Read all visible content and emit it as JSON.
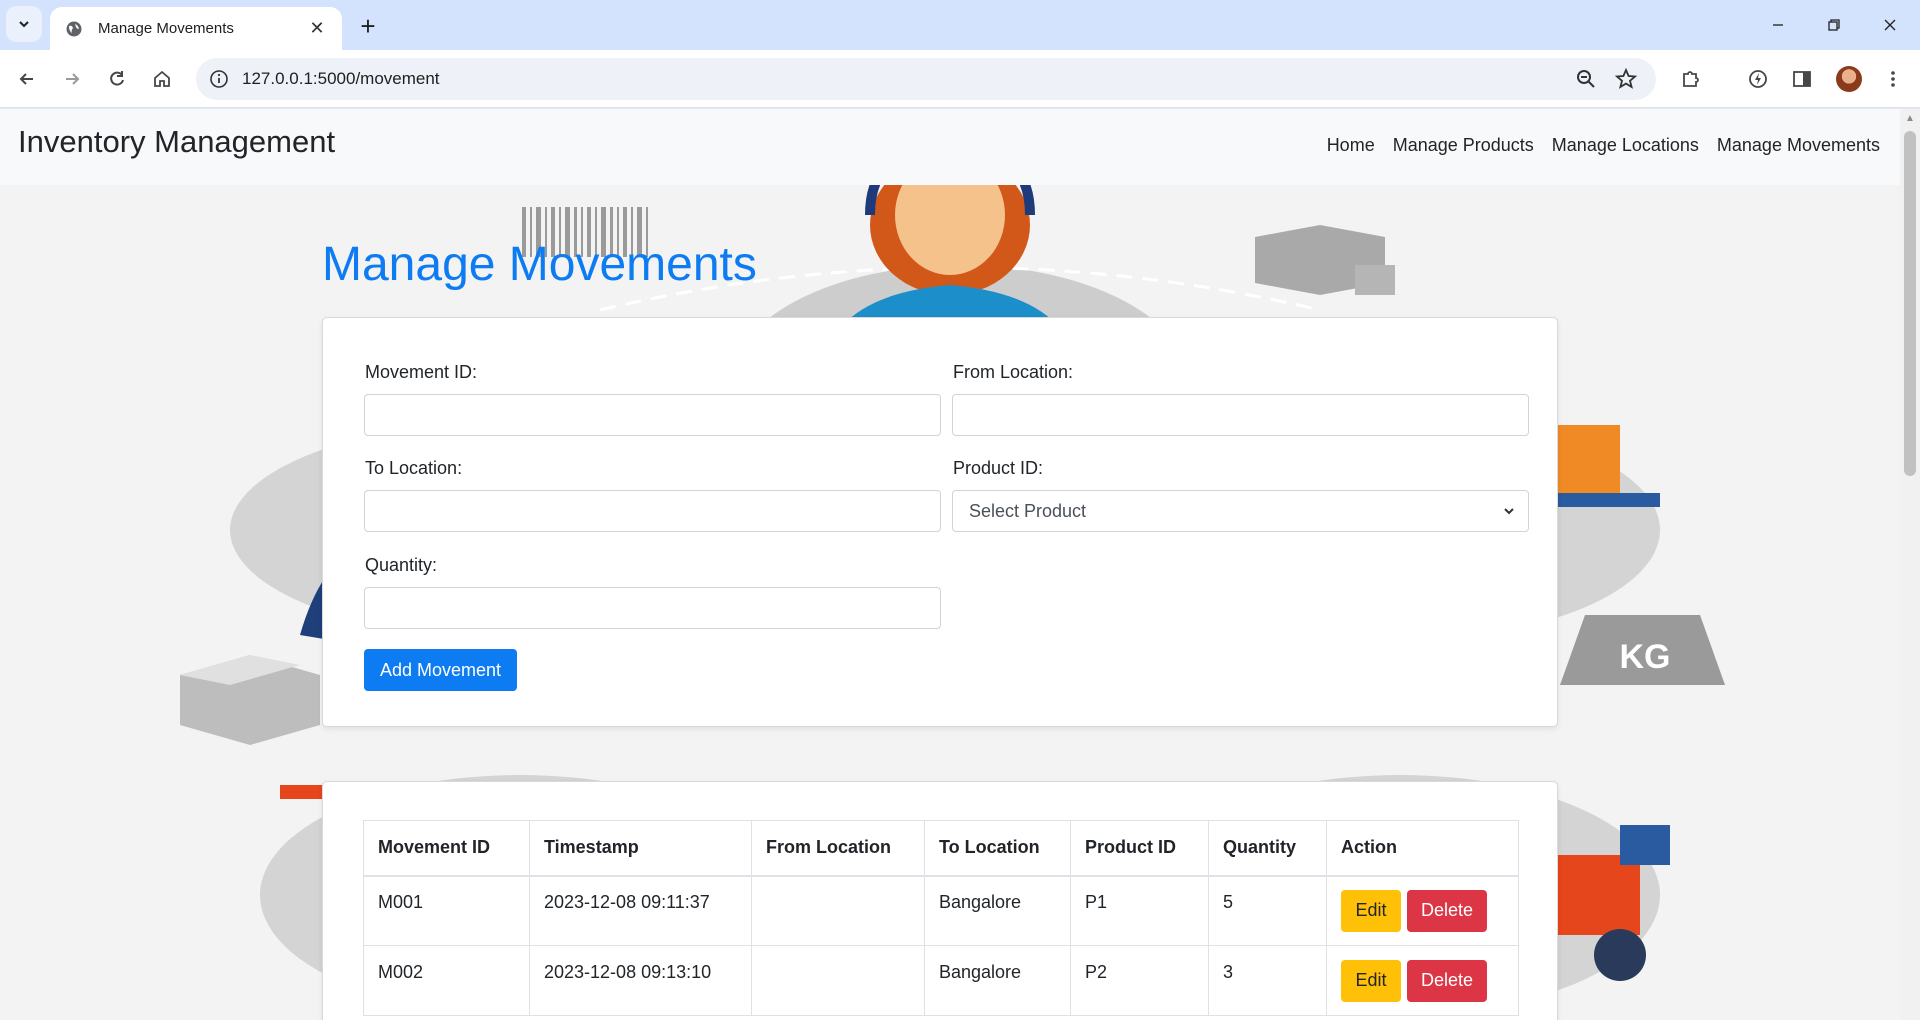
{
  "browser": {
    "tab_title": "Manage Movements",
    "url": "127.0.0.1:5000/movement"
  },
  "navbar": {
    "brand": "Inventory Management",
    "links": [
      "Home",
      "Manage Products",
      "Manage Locations",
      "Manage Movements"
    ]
  },
  "page": {
    "title": "Manage Movements"
  },
  "form": {
    "movement_id_label": "Movement ID:",
    "movement_id_value": "",
    "from_location_label": "From Location:",
    "from_location_value": "",
    "to_location_label": "To Location:",
    "to_location_value": "",
    "product_id_label": "Product ID:",
    "product_id_selected": "Select Product",
    "quantity_label": "Quantity:",
    "quantity_value": "",
    "submit_label": "Add Movement"
  },
  "table": {
    "headers": [
      "Movement ID",
      "Timestamp",
      "From Location",
      "To Location",
      "Product ID",
      "Quantity",
      "Action"
    ],
    "rows": [
      {
        "movement_id": "M001",
        "timestamp": "2023-12-08 09:11:37",
        "from_location": "",
        "to_location": "Bangalore",
        "product_id": "P1",
        "quantity": "5",
        "edit": "Edit",
        "delete": "Delete"
      },
      {
        "movement_id": "M002",
        "timestamp": "2023-12-08 09:13:10",
        "from_location": "",
        "to_location": "Bangalore",
        "product_id": "P2",
        "quantity": "3",
        "edit": "Edit",
        "delete": "Delete"
      }
    ]
  },
  "colors": {
    "primary": "#0d7bf2",
    "warning": "#ffc107",
    "danger": "#dc3545",
    "navbar_bg": "#f8f9fa"
  }
}
